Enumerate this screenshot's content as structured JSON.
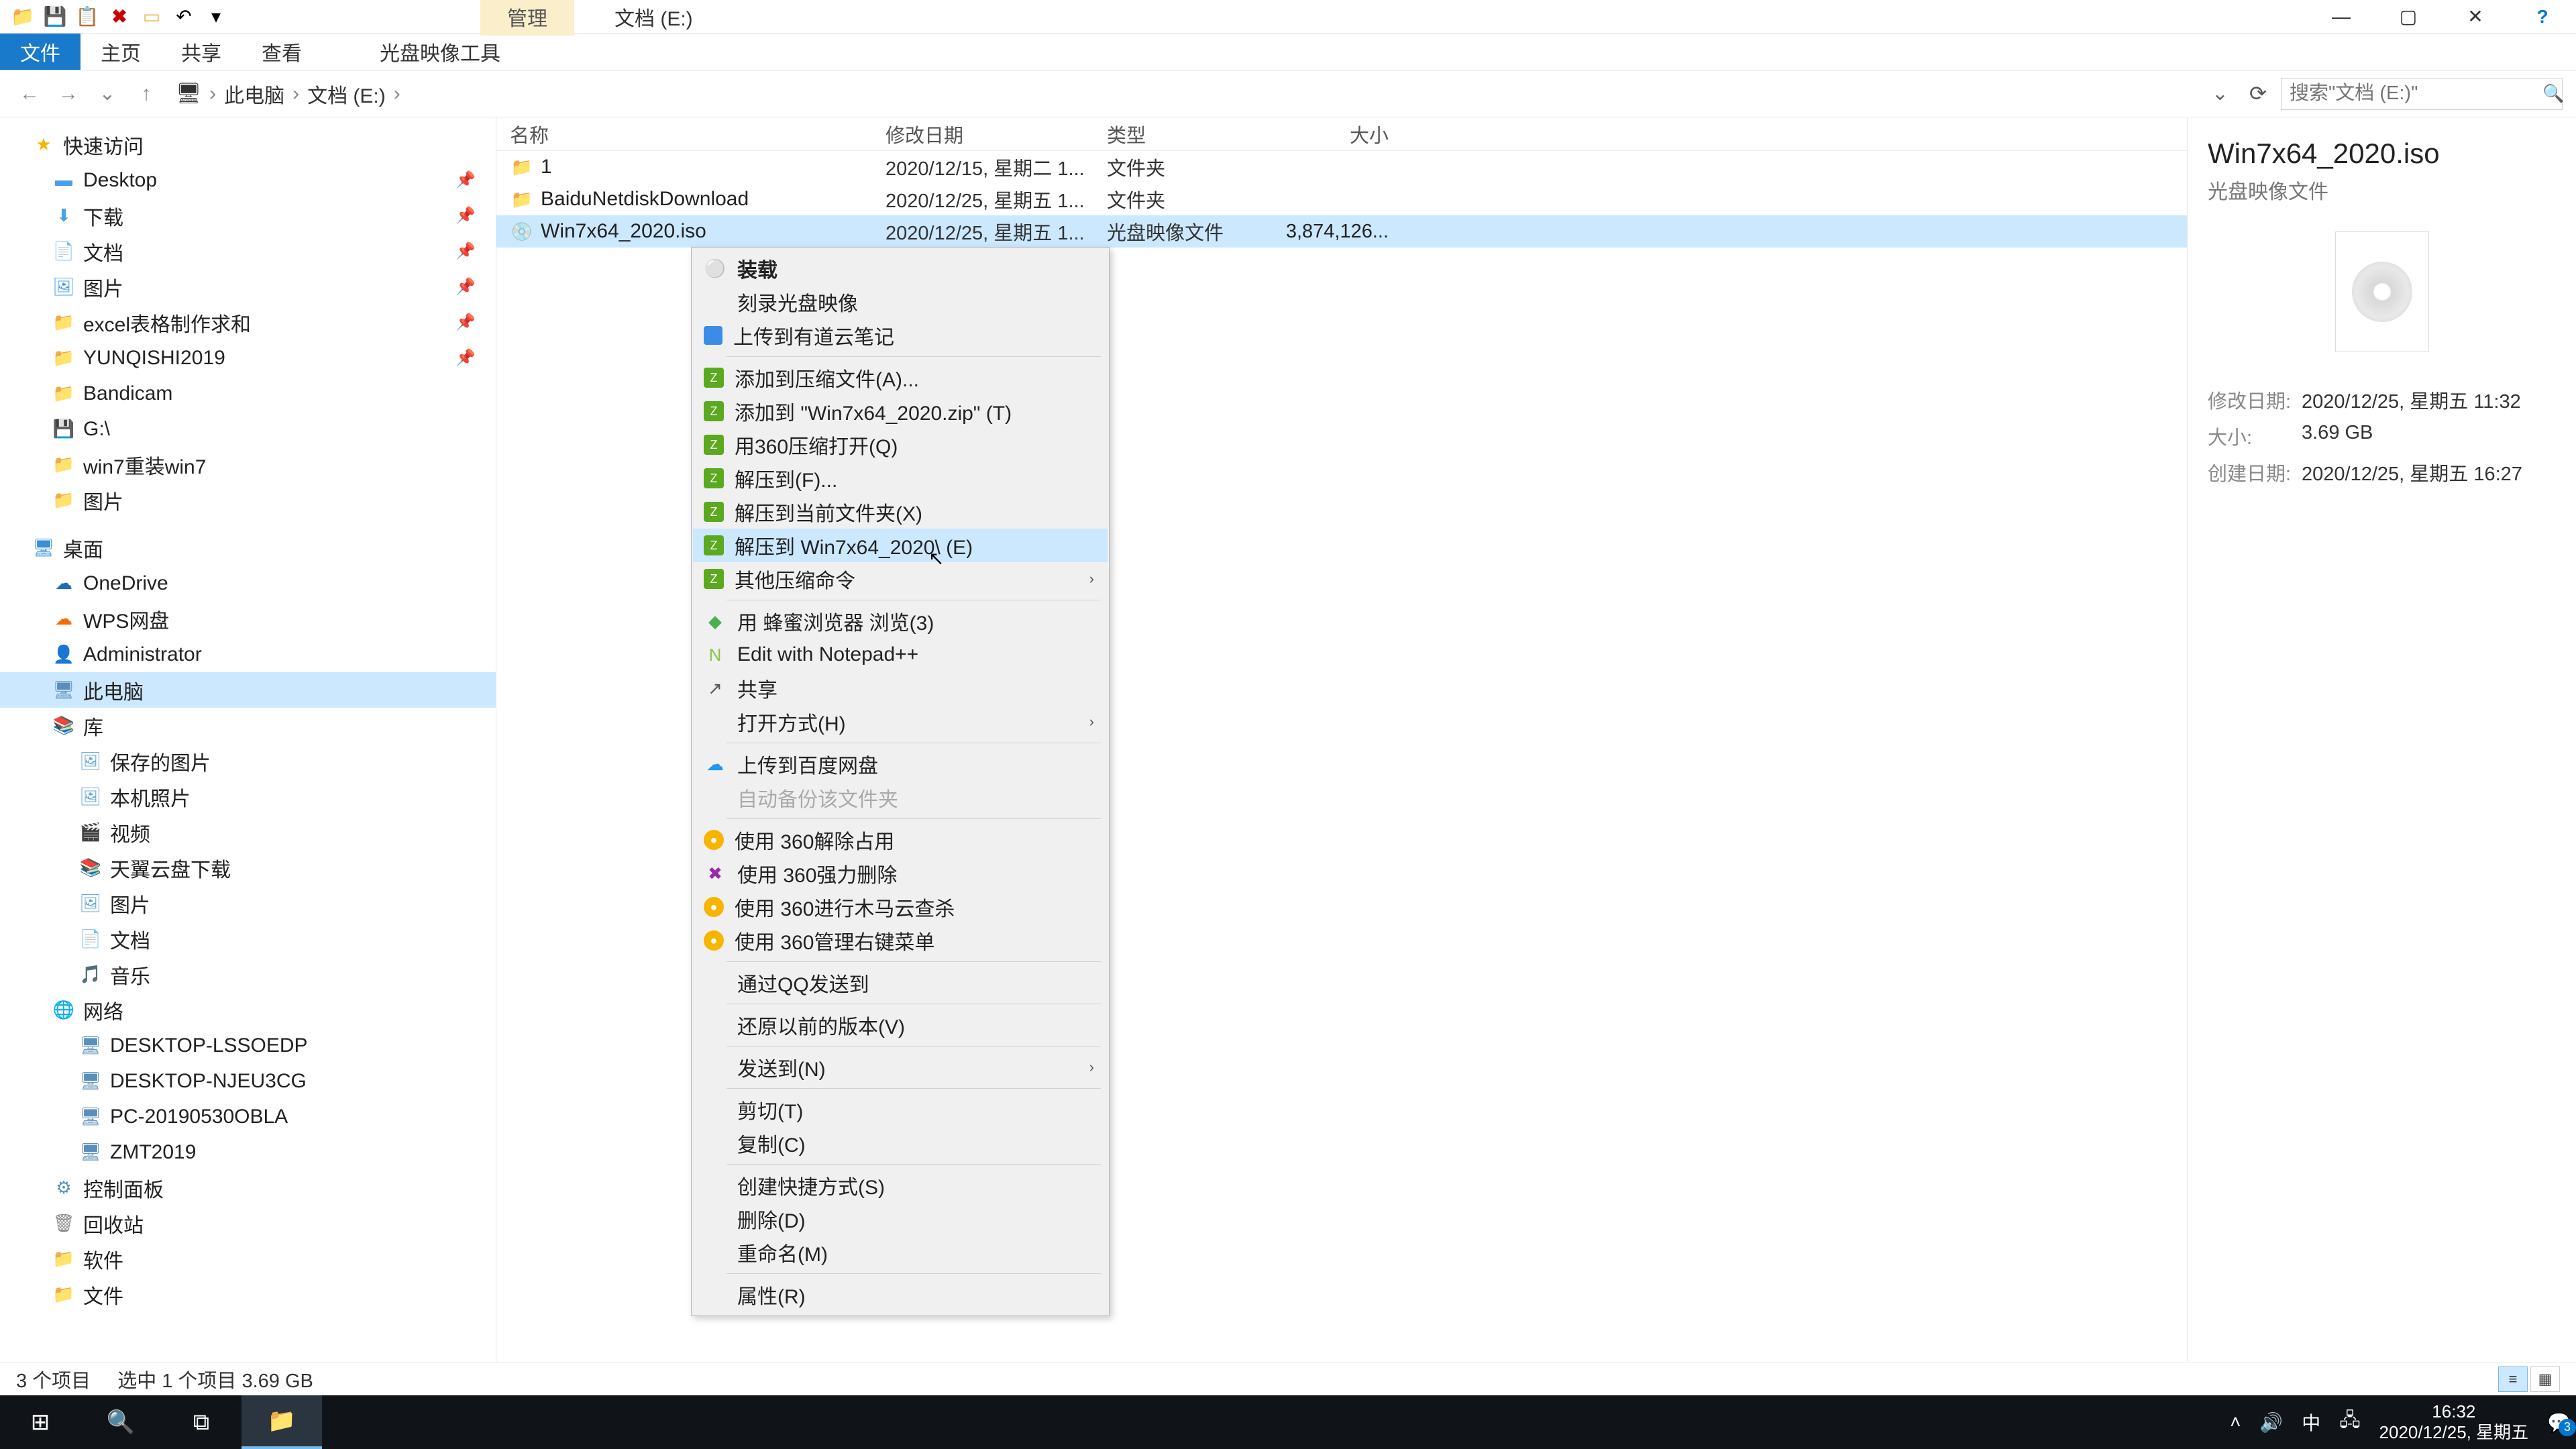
{
  "titlebar": {
    "manage_tab": "管理",
    "title": "文档 (E:)"
  },
  "win": {
    "min": "—",
    "max": "▢",
    "close": "✕",
    "help": "?"
  },
  "ribbon": {
    "file": "文件",
    "home": "主页",
    "share": "共享",
    "view": "查看",
    "disc_tools": "光盘映像工具"
  },
  "addr": {
    "root": "此电脑",
    "loc": "文档 (E:)",
    "search_ph": "搜索\"文档 (E:)\""
  },
  "tree": {
    "quick": "快速访问",
    "desktop": "Desktop",
    "down": "下载",
    "docs": "文档",
    "pics": "图片",
    "excel": "excel表格制作求和",
    "yunqi": "YUNQISHI2019",
    "bandi": "Bandicam",
    "g": "G:\\",
    "win7re": "win7重装win7",
    "pics2": "图片",
    "deskhdr": "桌面",
    "onedrive": "OneDrive",
    "wps": "WPS网盘",
    "admin": "Administrator",
    "thispc": "此电脑",
    "lib": "库",
    "savedpic": "保存的图片",
    "localpic": "本机照片",
    "video": "视频",
    "tianyi": "天翼云盘下载",
    "pic3": "图片",
    "doc3": "文档",
    "music": "音乐",
    "network": "网络",
    "pc1": "DESKTOP-LSSOEDP",
    "pc2": "DESKTOP-NJEU3CG",
    "pc3": "PC-20190530OBLA",
    "pc4": "ZMT2019",
    "ctrlpanel": "控制面板",
    "trash": "回收站",
    "soft": "软件",
    "file3": "文件"
  },
  "cols": {
    "name": "名称",
    "date": "修改日期",
    "type": "类型",
    "size": "大小"
  },
  "rows": [
    {
      "ico": "📁",
      "name": "1",
      "date": "2020/12/15, 星期二 1...",
      "type": "文件夹",
      "size": ""
    },
    {
      "ico": "📁",
      "name": "BaiduNetdiskDownload",
      "date": "2020/12/25, 星期五 1...",
      "type": "文件夹",
      "size": ""
    },
    {
      "ico": "💿",
      "name": "Win7x64_2020.iso",
      "date": "2020/12/25, 星期五 1...",
      "type": "光盘映像文件",
      "size": "3,874,126..."
    }
  ],
  "ctx": [
    {
      "t": "item",
      "ico": "⚪",
      "label": "装载",
      "bold": true
    },
    {
      "t": "item",
      "ico": "",
      "label": "刻录光盘映像"
    },
    {
      "t": "item",
      "ico": "blue",
      "label": "上传到有道云笔记"
    },
    {
      "t": "sep"
    },
    {
      "t": "item",
      "ico": "360",
      "label": "添加到压缩文件(A)..."
    },
    {
      "t": "item",
      "ico": "360",
      "label": "添加到 \"Win7x64_2020.zip\" (T)"
    },
    {
      "t": "item",
      "ico": "360",
      "label": "用360压缩打开(Q)"
    },
    {
      "t": "item",
      "ico": "360",
      "label": "解压到(F)..."
    },
    {
      "t": "item",
      "ico": "360",
      "label": "解压到当前文件夹(X)"
    },
    {
      "t": "item",
      "ico": "360",
      "label": "解压到 Win7x64_2020\\ (E)",
      "hover": true
    },
    {
      "t": "item",
      "ico": "360",
      "label": "其他压缩命令",
      "sub": true
    },
    {
      "t": "sep"
    },
    {
      "t": "item",
      "ico": "green",
      "label": "用 蜂蜜浏览器 浏览(3)"
    },
    {
      "t": "item",
      "ico": "npp",
      "label": "Edit with Notepad++"
    },
    {
      "t": "item",
      "ico": "share",
      "label": "共享"
    },
    {
      "t": "item",
      "ico": "",
      "label": "打开方式(H)",
      "sub": true
    },
    {
      "t": "sep"
    },
    {
      "t": "item",
      "ico": "baidu",
      "label": "上传到百度网盘"
    },
    {
      "t": "item",
      "ico": "",
      "label": "自动备份该文件夹",
      "disabled": true
    },
    {
      "t": "sep"
    },
    {
      "t": "item",
      "ico": "360y",
      "label": "使用 360解除占用"
    },
    {
      "t": "item",
      "ico": "del",
      "label": "使用 360强力删除"
    },
    {
      "t": "item",
      "ico": "360y",
      "label": "使用 360进行木马云查杀"
    },
    {
      "t": "item",
      "ico": "360y",
      "label": "使用 360管理右键菜单"
    },
    {
      "t": "sep"
    },
    {
      "t": "item",
      "ico": "",
      "label": "通过QQ发送到"
    },
    {
      "t": "sep"
    },
    {
      "t": "item",
      "ico": "",
      "label": "还原以前的版本(V)"
    },
    {
      "t": "sep"
    },
    {
      "t": "item",
      "ico": "",
      "label": "发送到(N)",
      "sub": true
    },
    {
      "t": "sep"
    },
    {
      "t": "item",
      "ico": "",
      "label": "剪切(T)"
    },
    {
      "t": "item",
      "ico": "",
      "label": "复制(C)"
    },
    {
      "t": "sep"
    },
    {
      "t": "item",
      "ico": "",
      "label": "创建快捷方式(S)"
    },
    {
      "t": "item",
      "ico": "",
      "label": "删除(D)"
    },
    {
      "t": "item",
      "ico": "",
      "label": "重命名(M)"
    },
    {
      "t": "sep"
    },
    {
      "t": "item",
      "ico": "",
      "label": "属性(R)"
    }
  ],
  "details": {
    "title": "Win7x64_2020.iso",
    "subtitle": "光盘映像文件",
    "mod_label": "修改日期:",
    "mod_val": "2020/12/25, 星期五 11:32",
    "size_label": "大小:",
    "size_val": "3.69 GB",
    "created_label": "创建日期:",
    "created_val": "2020/12/25, 星期五 16:27"
  },
  "status": {
    "count": "3 个项目",
    "sel": "选中 1 个项目  3.69 GB"
  },
  "taskbar": {
    "time": "16:32",
    "date": "2020/12/25, 星期五",
    "badge": "3"
  }
}
